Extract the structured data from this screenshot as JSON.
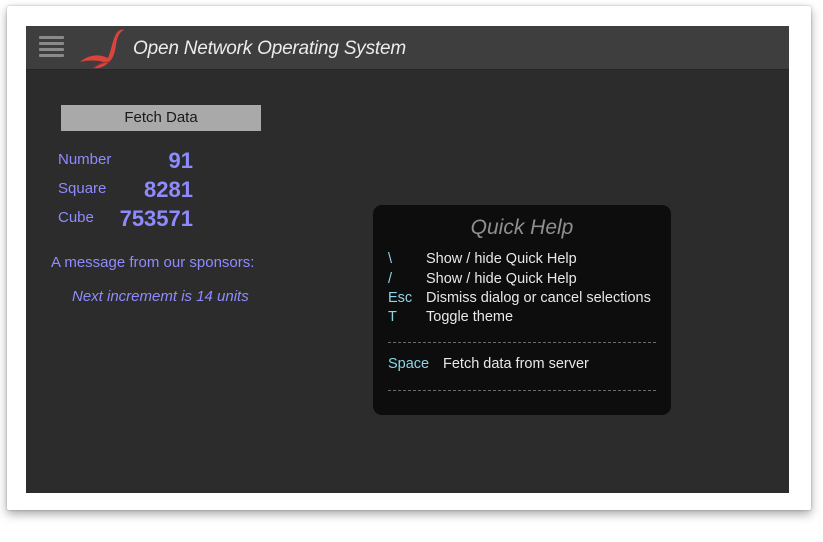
{
  "masthead": {
    "title": "Open Network Operating System"
  },
  "main": {
    "fetch_button_label": "Fetch Data",
    "metrics": [
      {
        "label": "Number",
        "value": "91"
      },
      {
        "label": "Square",
        "value": "8281"
      },
      {
        "label": "Cube",
        "value": "753571"
      }
    ],
    "sponsor_heading": "A message from our sponsors:",
    "sponsor_message": "Next incrememt is 14 units"
  },
  "quick_help": {
    "title": "Quick Help",
    "global_bindings": [
      {
        "key": "\\",
        "desc": "Show / hide Quick Help"
      },
      {
        "key": "/",
        "desc": "Show / hide Quick Help"
      },
      {
        "key": "Esc",
        "desc": "Dismiss dialog or cancel selections"
      },
      {
        "key": "T",
        "desc": "Toggle theme"
      }
    ],
    "view_bindings": [
      {
        "key": "Space",
        "desc": "Fetch data from server"
      }
    ]
  },
  "colors": {
    "accent_text": "#8f8bff",
    "key_text": "#8fd4e6",
    "logo_red": "#d9443c",
    "masthead_bg": "#3e3e3e",
    "body_bg": "#2c2c2c"
  },
  "icons": {
    "nav": "hamburger-menu-icon",
    "logo": "onos-bird-logo"
  }
}
